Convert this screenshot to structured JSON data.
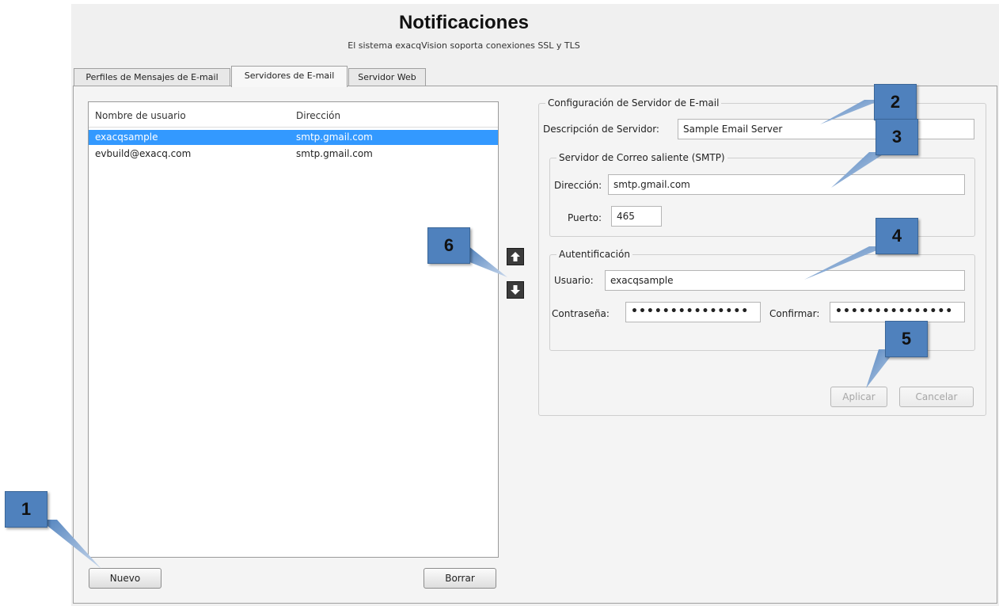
{
  "header": {
    "title": "Notificaciones",
    "subtitle": "El sistema exacqVision soporta conexiones SSL y TLS"
  },
  "tabs": [
    {
      "label": "Perfiles de Mensajes de E-mail",
      "active": false
    },
    {
      "label": "Servidores de E-mail",
      "active": true
    },
    {
      "label": "Servidor Web",
      "active": false
    }
  ],
  "server_list": {
    "columns": [
      "Nombre de usuario",
      "Dirección"
    ],
    "rows": [
      {
        "user": "exacqsample",
        "address": "smtp.gmail.com",
        "selected": true
      },
      {
        "user": "evbuild@exacq.com",
        "address": "smtp.gmail.com",
        "selected": false
      }
    ],
    "new_button": "Nuevo",
    "delete_button": "Borrar",
    "move_up_icon": "arrow-up-icon",
    "move_down_icon": "arrow-down-icon"
  },
  "config": {
    "group_title": "Configuración de Servidor de E-mail",
    "description_label": "Descripción de Servidor:",
    "description_value": "Sample Email Server",
    "smtp": {
      "group_title": "Servidor de Correo saliente (SMTP)",
      "address_label": "Dirección:",
      "address_value": "smtp.gmail.com",
      "port_label": "Puerto:",
      "port_value": "465"
    },
    "auth": {
      "group_title": "Autentificación",
      "user_label": "Usuario:",
      "user_value": "exacqsample",
      "password_label": "Contraseña:",
      "password_value": "•••••••••••••••",
      "confirm_label": "Confirmar:",
      "confirm_value": "•••••••••••••••"
    },
    "apply_button": "Aplicar",
    "cancel_button": "Cancelar"
  },
  "callouts": [
    "1",
    "2",
    "3",
    "4",
    "5",
    "6"
  ],
  "colors": {
    "selection": "#3399ff",
    "callout": "#4f81bd",
    "window_bg": "#f0f0f0"
  }
}
